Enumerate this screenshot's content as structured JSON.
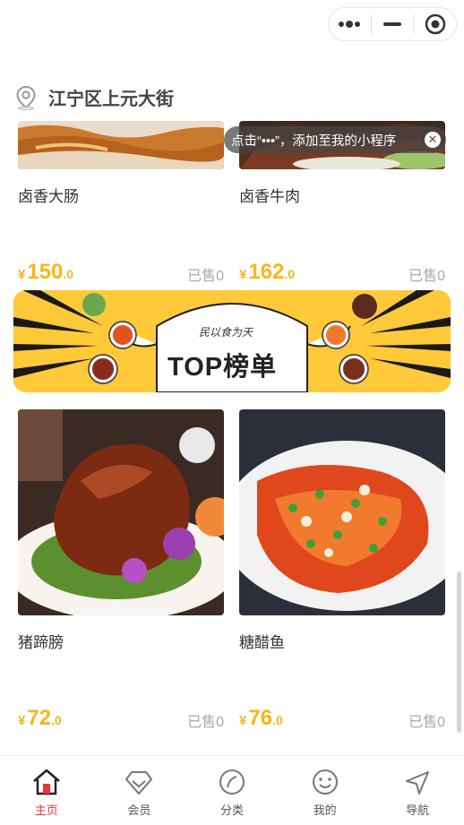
{
  "location": {
    "text": "江宁区上元大街",
    "icon": "location-pin-icon"
  },
  "tooltip": {
    "text": "点击“•••”，添加至我的小程序"
  },
  "banner": {
    "motto": "民以食为天",
    "title": "TOP榜单"
  },
  "products": [
    {
      "name": "卤香大肠",
      "currency": "¥",
      "price_int": "150",
      "price_dec": ".0",
      "sold": "已售0"
    },
    {
      "name": "卤香牛肉",
      "currency": "¥",
      "price_int": "162",
      "price_dec": ".0",
      "sold": "已售0"
    },
    {
      "name": "猪蹄膀",
      "currency": "¥",
      "price_int": "72",
      "price_dec": ".0",
      "sold": "已售0"
    },
    {
      "name": "糖醋鱼",
      "currency": "¥",
      "price_int": "76",
      "price_dec": ".0",
      "sold": "已售0"
    }
  ],
  "tabs": [
    {
      "label": "主页",
      "icon": "home-icon",
      "active": true
    },
    {
      "label": "会员",
      "icon": "diamond-icon",
      "active": false
    },
    {
      "label": "分类",
      "icon": "compass-icon",
      "active": false
    },
    {
      "label": "我的",
      "icon": "smiley-icon",
      "active": false
    },
    {
      "label": "导航",
      "icon": "navigation-icon",
      "active": false
    }
  ],
  "colors": {
    "price": "#f7b619",
    "active_tab": "#e33333",
    "banner_bg": "#ffc93a"
  }
}
